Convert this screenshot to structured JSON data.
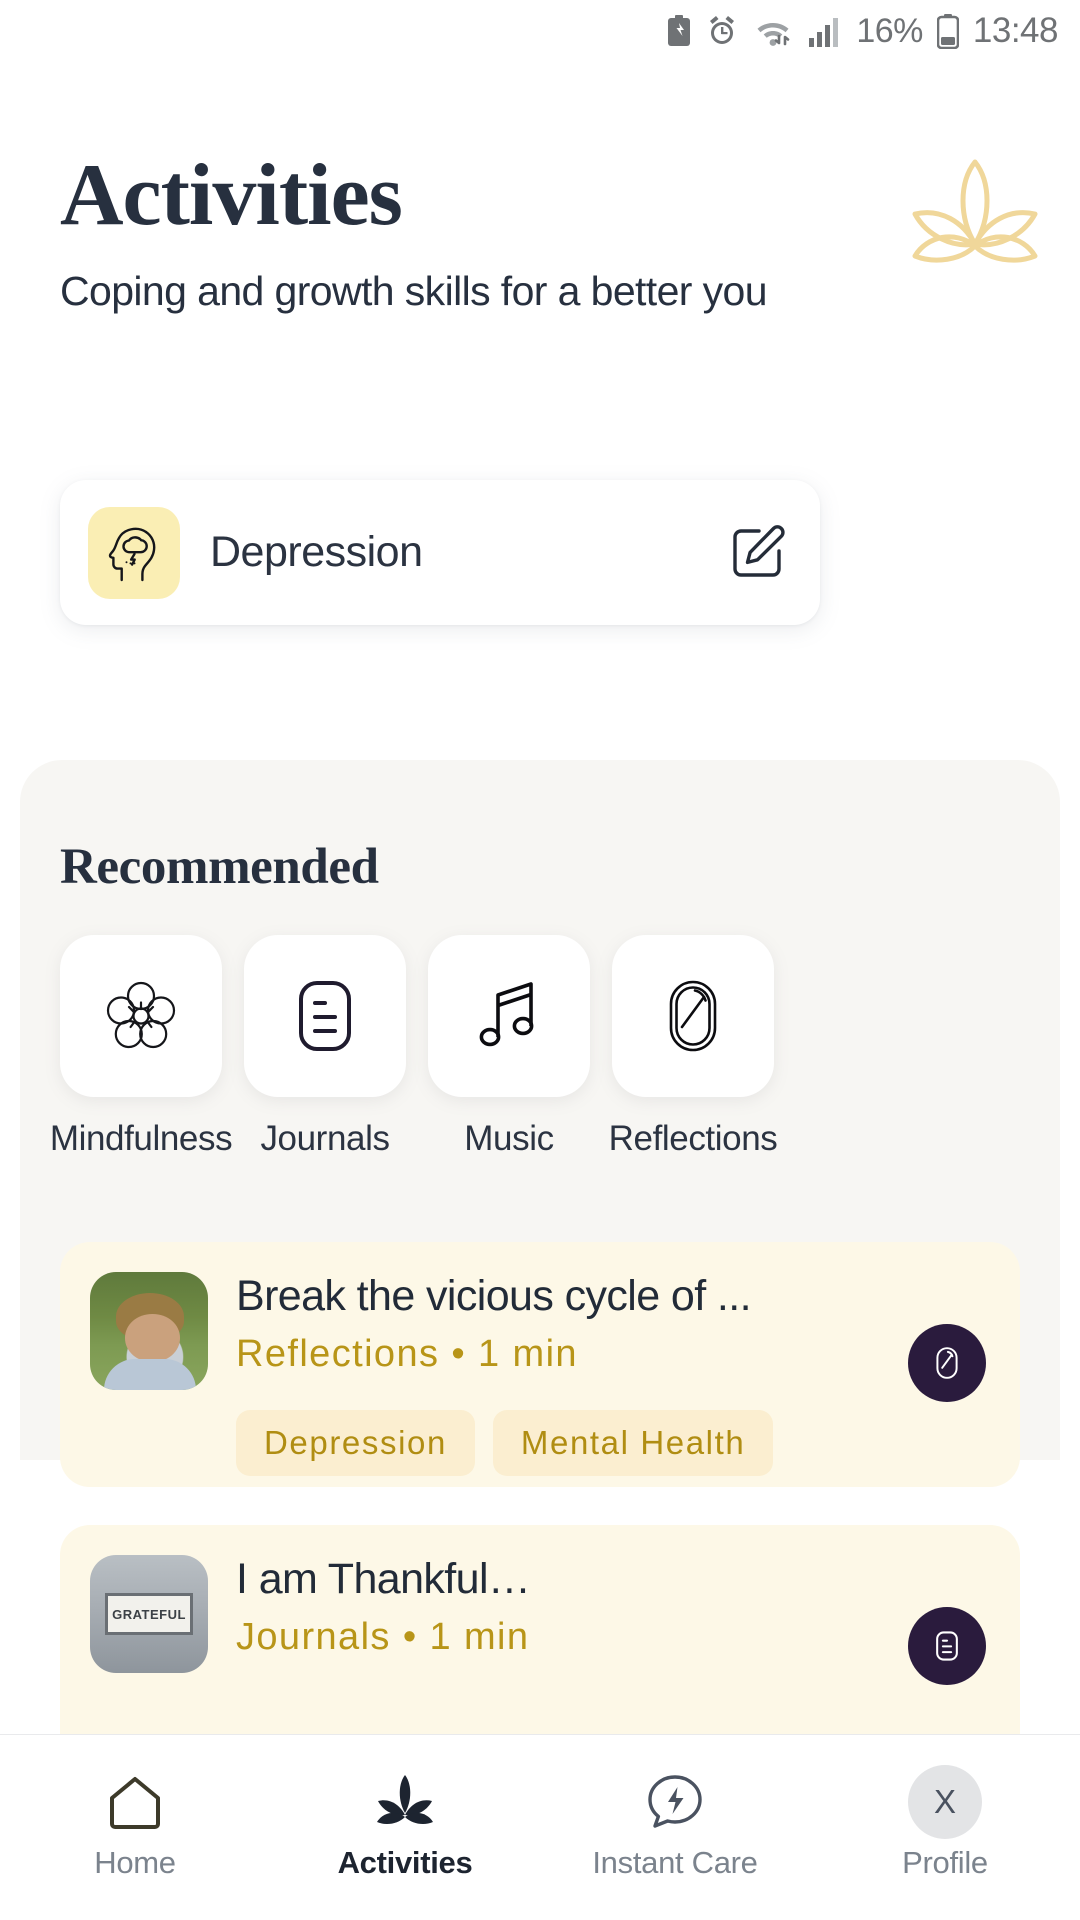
{
  "status_bar": {
    "battery_percent": "16%",
    "time": "13:48",
    "icons": [
      "battery-saver-icon",
      "alarm-icon",
      "wifi-icon",
      "signal-icon",
      "battery-icon"
    ]
  },
  "header": {
    "title": "Activities",
    "subtitle": "Coping and growth skills for a better you",
    "decoration": "lotus-icon"
  },
  "topic_card": {
    "icon": "head-depression-icon",
    "label": "Depression",
    "edit_icon": "edit-pencil-icon"
  },
  "recommended": {
    "title": "Recommended",
    "categories": [
      {
        "label": "Mindfulness",
        "icon": "flower-icon"
      },
      {
        "label": "Journals",
        "icon": "document-lines-icon"
      },
      {
        "label": "Music",
        "icon": "music-note-icon"
      },
      {
        "label": "Reflections",
        "icon": "mirror-icon"
      }
    ],
    "activities": [
      {
        "title": "Break the vicious cycle of ...",
        "category": "Reflections",
        "duration": "1 min",
        "separator": "•",
        "tags": [
          "Depression",
          "Mental Health"
        ],
        "badge_icon": "mirror-icon",
        "thumbnail": "woman-smiling-forest-photo"
      },
      {
        "title": "I am Thankful…",
        "category": "Journals",
        "duration": "1 min",
        "separator": "•",
        "tags": [],
        "badge_icon": "document-lines-icon",
        "thumbnail": "grateful-sign-photo",
        "thumbnail_text": "GRATEFUL"
      }
    ]
  },
  "bottom_nav": [
    {
      "label": "Home",
      "icon": "home-icon",
      "active": false
    },
    {
      "label": "Activities",
      "icon": "lotus-icon",
      "active": true
    },
    {
      "label": "Instant Care",
      "icon": "bolt-chat-icon",
      "active": false
    },
    {
      "label": "Profile",
      "icon": "avatar-icon",
      "avatar_letter": "X",
      "active": false
    }
  ],
  "colors": {
    "accent_gold": "#b89518",
    "card_cream": "#fdf8e7",
    "tag_cream": "#fbeed0",
    "topic_icon_bg": "#faeeb4",
    "panel_bg": "#f7f6f3",
    "text_dark": "#27303f",
    "badge_dark": "#2a1b3d",
    "lotus_gold": "#f0d79a"
  }
}
